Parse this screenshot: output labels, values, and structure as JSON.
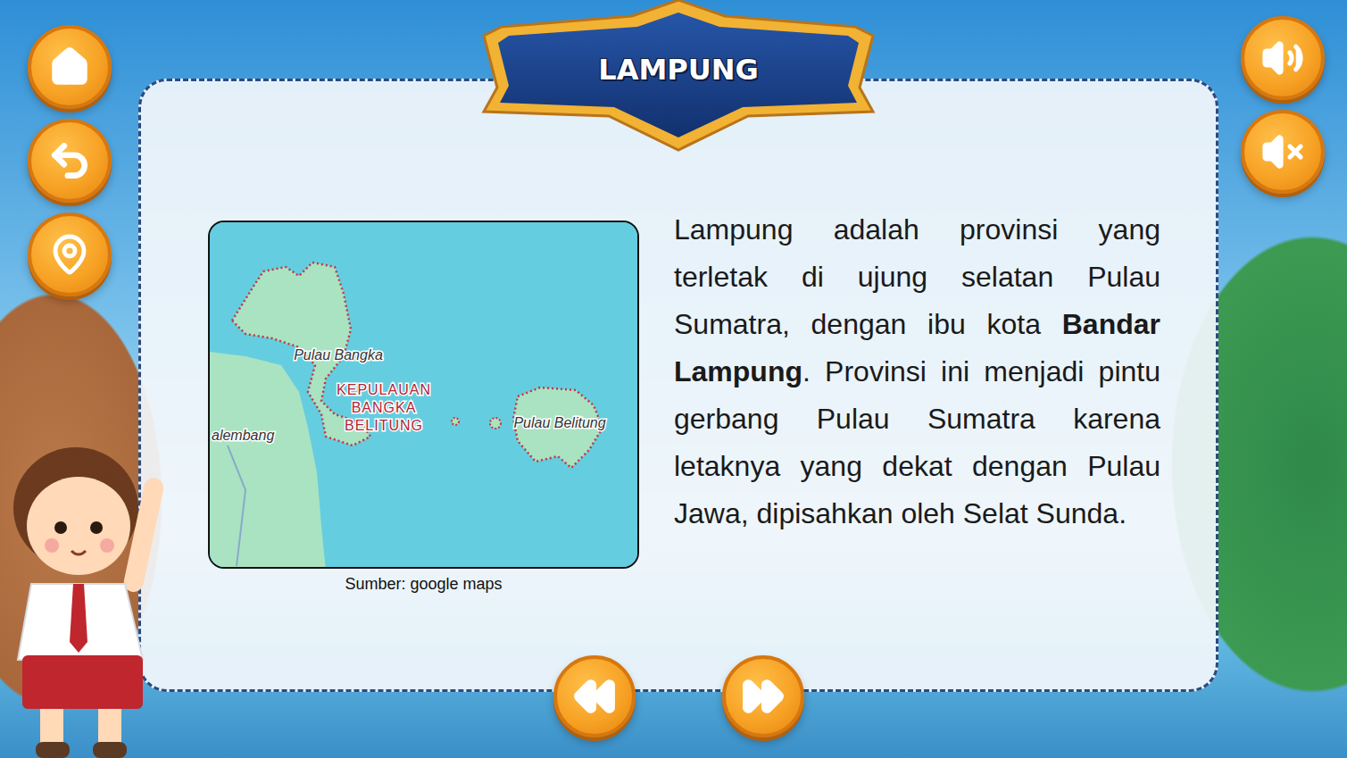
{
  "title": "LAMPUNG",
  "map": {
    "labels": [
      {
        "text": "Pulau Bangka",
        "kind": "island"
      },
      {
        "text": "KEPULAUAN BANGKA BELITUNG",
        "kind": "province"
      },
      {
        "text": "Pulau Belitung",
        "kind": "island"
      },
      {
        "text": "alembang",
        "kind": "city"
      }
    ],
    "caption": "Sumber: google maps"
  },
  "description": [
    {
      "text": "Lampung adalah provinsi yang terletak di ujung selatan Pulau Sumatra, dengan ibu kota ",
      "bold": false
    },
    {
      "text": "Bandar Lampung",
      "bold": true
    },
    {
      "text": ". Provinsi ini menjadi pintu gerbang Pulau Sumatra karena letaknya yang dekat dengan Pulau Jawa, dipisahkan oleh Selat Sunda.",
      "bold": false
    }
  ]
}
